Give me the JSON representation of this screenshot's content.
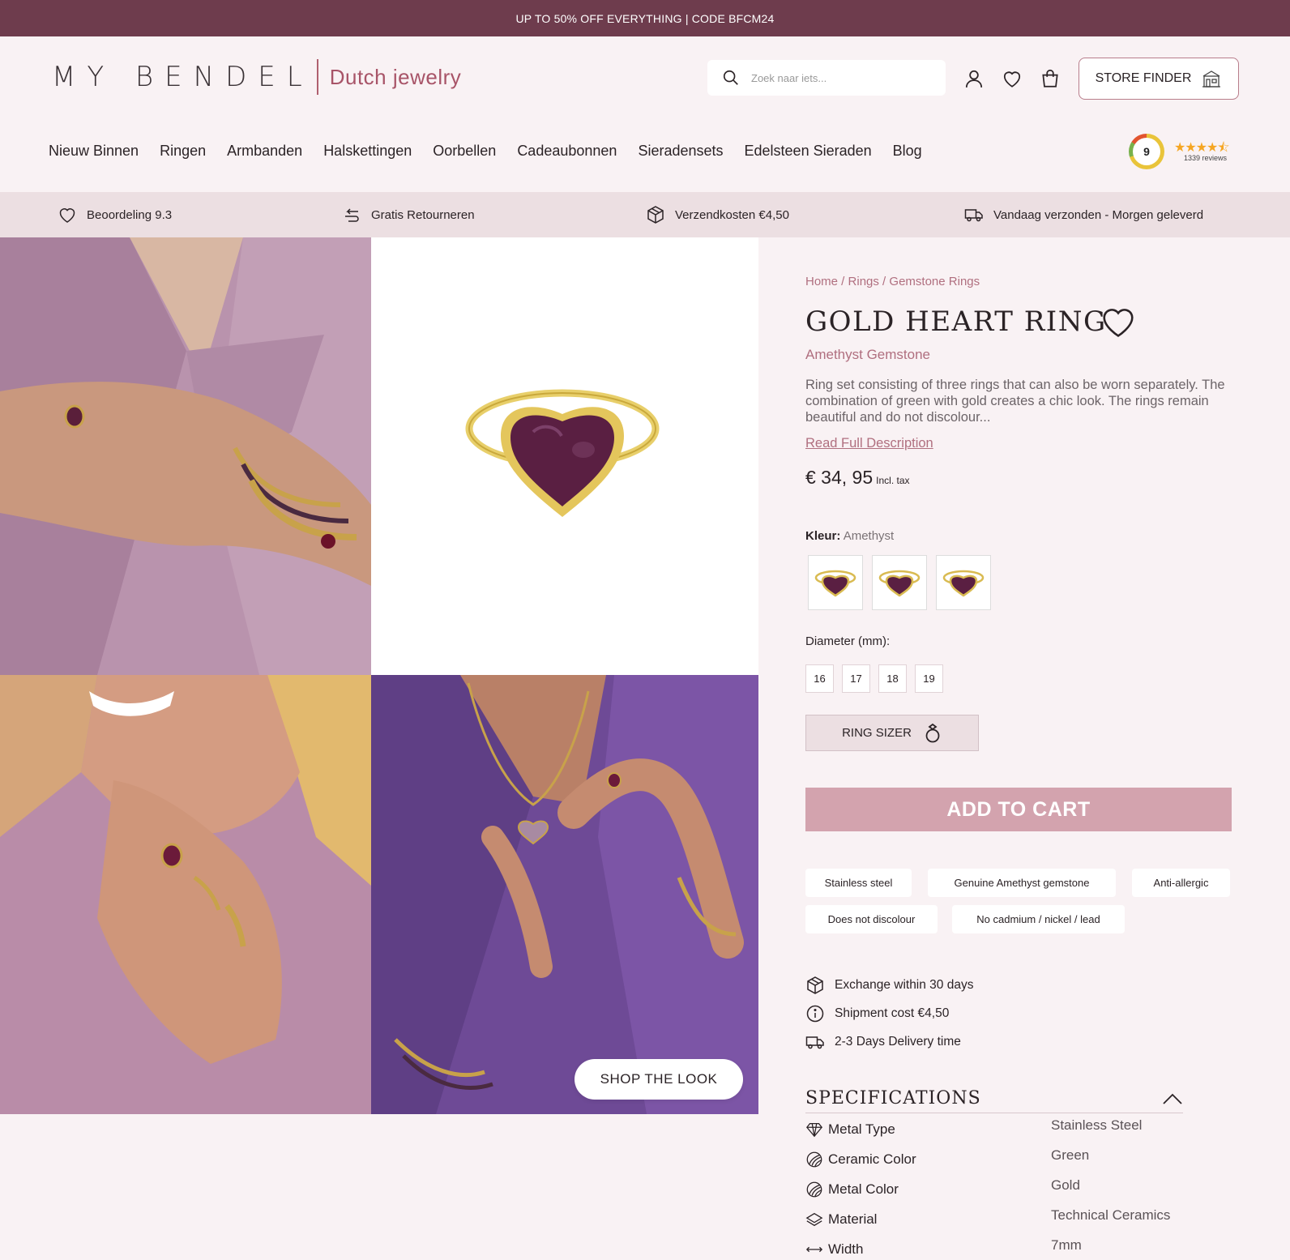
{
  "promo": {
    "text": "UP TO 50% OFF EVERYTHING | CODE BFCM24"
  },
  "header": {
    "logo_main": "MY BENDEL",
    "logo_sub": "Dutch jewelry",
    "search_placeholder": "Zoek naar iets...",
    "store_finder": "STORE FINDER"
  },
  "nav": {
    "items": [
      "Nieuw Binnen",
      "Ringen",
      "Armbanden",
      "Halskettingen",
      "Oorbellen",
      "Cadeaubonnen",
      "Sieradensets",
      "Edelsteen Sieraden",
      "Blog"
    ]
  },
  "rating": {
    "score": "9",
    "stars": "★★★★⯪",
    "count": "1339 reviews"
  },
  "usps": [
    {
      "label": "Beoordeling 9.3",
      "icon": "heart-icon"
    },
    {
      "label": "Gratis Retourneren",
      "icon": "return-icon"
    },
    {
      "label": "Verzendkosten €4,50",
      "icon": "box-icon"
    },
    {
      "label": "Vandaag verzonden - Morgen geleverd",
      "icon": "truck-icon"
    }
  ],
  "gallery": {
    "shop_the_look": "SHOP THE LOOK"
  },
  "product": {
    "breadcrumb": {
      "home": "Home",
      "sep1": " / ",
      "rings": "Rings",
      "sep2": " / ",
      "category": "Gemstone Rings"
    },
    "title": "GOLD HEART RING",
    "subtitle": "Amethyst Gemstone",
    "description": "Ring set consisting of three rings that can also be worn separately. The combination of green with gold creates a chic look. The rings remain beautiful and do not discolour...",
    "read_more": "Read Full Description",
    "price": "€ 34, 95",
    "price_note": "Incl. tax",
    "color_label": "Kleur:",
    "color_value": "Amethyst",
    "diameter_label": "Diameter (mm):",
    "sizes": [
      "16",
      "17",
      "18",
      "19"
    ],
    "ring_sizer": "RING SIZER",
    "add_to_cart": "ADD TO CART",
    "tags": [
      "Stainless steel",
      "Genuine Amethyst gemstone",
      "Anti-allergic",
      "Does not discolour",
      "No cadmium / nickel / lead"
    ],
    "info": [
      {
        "label": "Exchange within 30 days",
        "icon": "box-icon"
      },
      {
        "label": "Shipment cost €4,50",
        "icon": "info-icon"
      },
      {
        "label": "2-3 Days Delivery time",
        "icon": "truck-icon"
      }
    ],
    "specs_title": "SPECIFICATIONS",
    "specs": [
      {
        "key": "Metal Type",
        "value": "Stainless Steel",
        "icon": "diamond-icon"
      },
      {
        "key": "Ceramic Color",
        "value": "Green",
        "icon": "palette-icon"
      },
      {
        "key": "Metal Color",
        "value": "Gold",
        "icon": "palette-icon"
      },
      {
        "key": "Material",
        "value": "Technical Ceramics",
        "icon": "layers-icon"
      },
      {
        "key": "Width",
        "value": "7mm",
        "icon": "width-icon"
      }
    ]
  },
  "colors": {
    "promo_bg": "#6e3c4d",
    "accent": "#b06f7f",
    "cart_button": "#d3a3ae",
    "usp_bg": "#ecdfe2",
    "page_bg": "#f9f2f4"
  }
}
